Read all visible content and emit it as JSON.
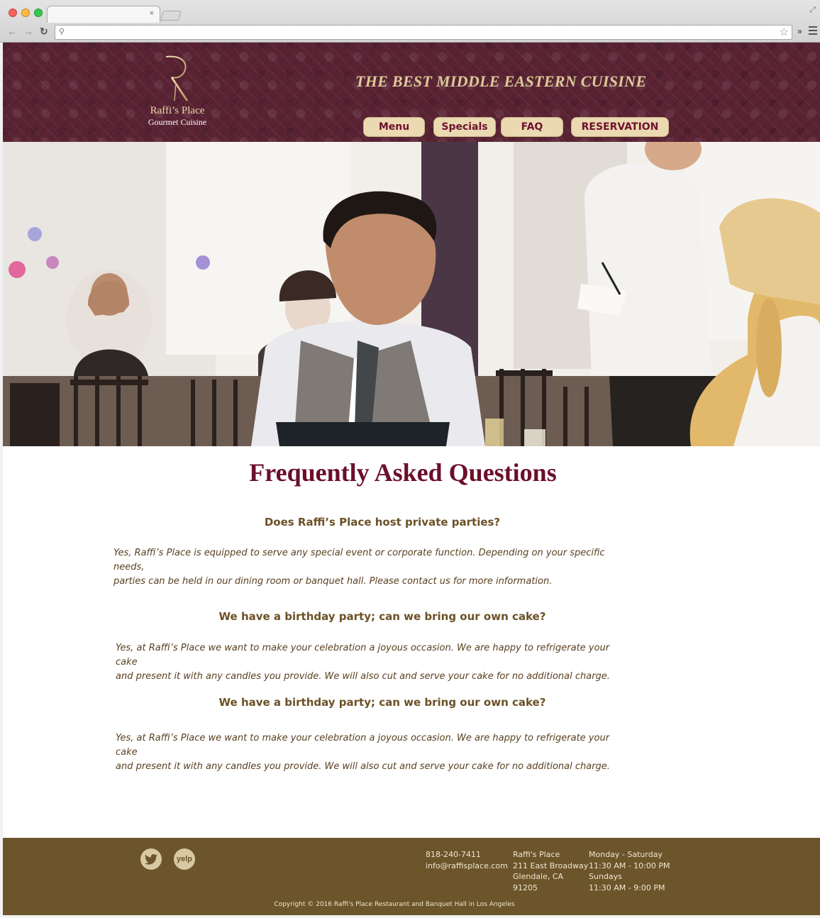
{
  "browser": {
    "tab_close": "×",
    "address_value": ""
  },
  "site": {
    "logo_name": "Raffi’s Place",
    "logo_sub": "Gourmet Cuisine",
    "tagline": "THE BEST MIDDLE EASTERN CUISINE",
    "nav": [
      {
        "label": "Menu"
      },
      {
        "label": "Specials"
      },
      {
        "label": "FAQ"
      },
      {
        "label": "RESERVATION"
      }
    ],
    "colors": {
      "header": "#5a2334",
      "nav_button": "#ead9b1",
      "title": "#6b0f2b",
      "text": "#6b5126",
      "footer": "#6c552b"
    }
  },
  "faq": {
    "title": "Frequently Asked Questions",
    "items": [
      {
        "question": "Does Raffi’s Place host private parties?",
        "answer_line1": "Yes, Raffi’s Place is equipped to serve any special event or corporate function.  Depending on your specific needs,",
        "answer_line2": "parties can be held in our dining room or banquet hall. Please contact us for more information."
      },
      {
        "question": "We have a birthday party; can we bring our own cake?",
        "answer_line1": "Yes, at Raffi’s Place we want to make your celebration a joyous occasion. We are happy to refrigerate your cake",
        "answer_line2": "and present it with any candles you provide. We will also cut and serve your cake for no additional charge."
      },
      {
        "question": "We have a birthday party; can we bring our own cake?",
        "answer_line1": "Yes, at Raffi’s Place we want to make your celebration a joyous occasion. We are happy to refrigerate your cake",
        "answer_line2": "and present it with any candles you provide. We will also cut and serve your cake for no additional charge."
      }
    ]
  },
  "footer": {
    "social": [
      {
        "icon": "twitter-icon"
      },
      {
        "icon": "yelp-icon",
        "label": "yelp"
      }
    ],
    "phone": "818-240-7411",
    "email": "info@raffisplace.com",
    "address": [
      "Raffi's Place",
      "211 East Broadway",
      "Glendale, CA",
      "91205"
    ],
    "hours": [
      "Monday - Saturday",
      "11:30 AM - 10:00 PM",
      "Sundays",
      "11:30 AM - 9:00 PM"
    ],
    "copyright": "Copyright © 2016 Raffi's Place Restaurant and Banquet Hall in Los Angeles"
  }
}
